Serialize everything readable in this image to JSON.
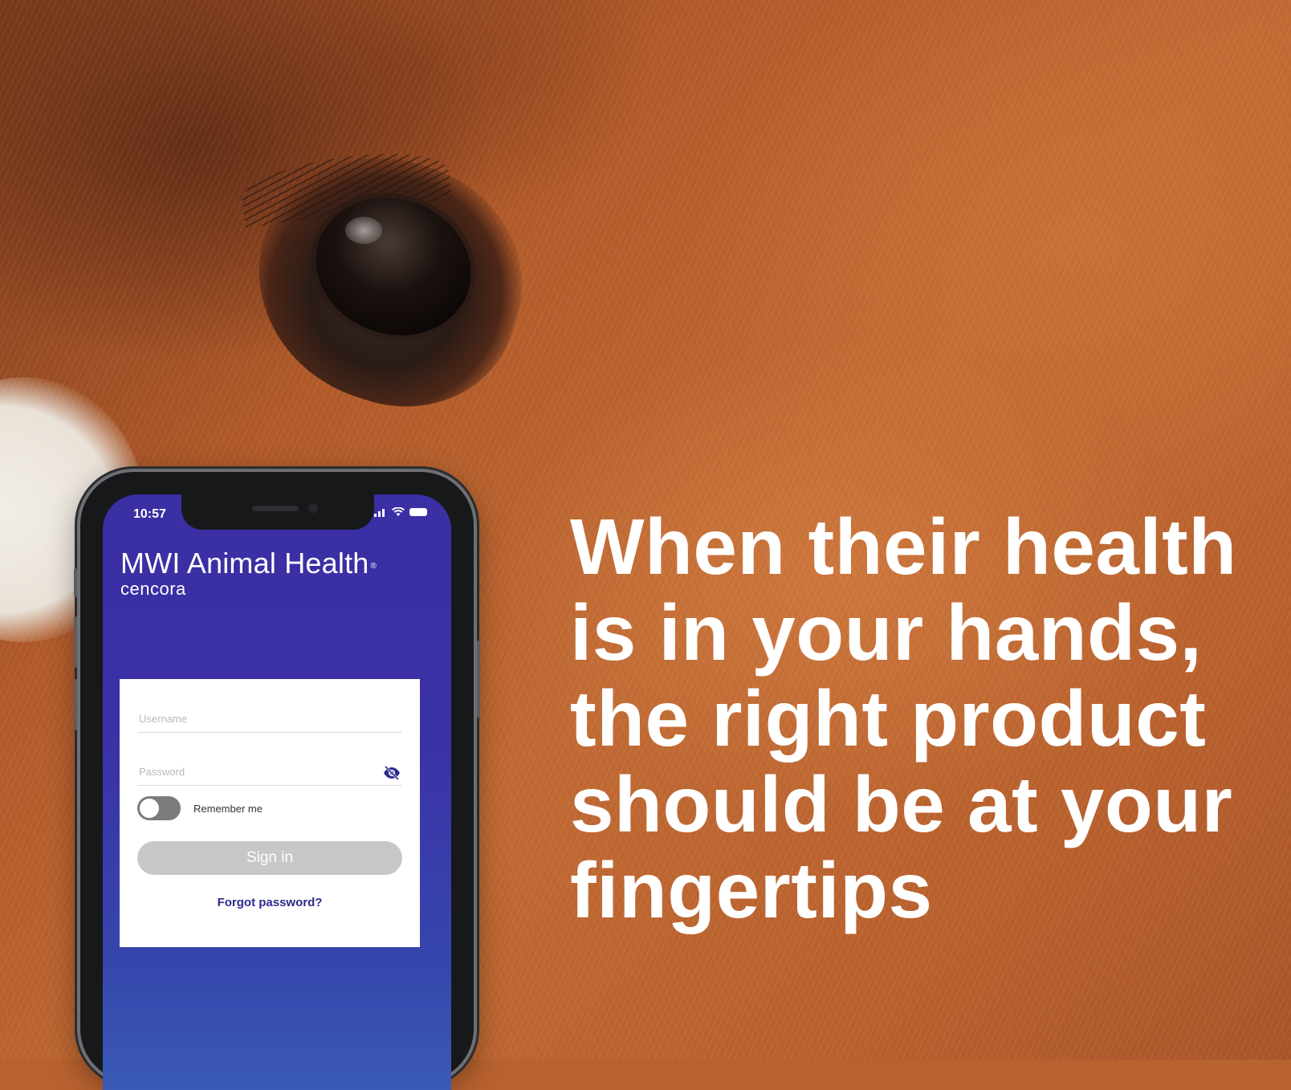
{
  "headline": {
    "lines": [
      "When their health",
      "is in your hands,",
      "the right product",
      "should be at your",
      "fingertips"
    ]
  },
  "phone": {
    "status_bar": {
      "time": "10:57",
      "icons": [
        "signal-icon",
        "wifi-icon",
        "battery-icon"
      ]
    },
    "brand": {
      "name": "MWI Animal Health",
      "registered_mark": "®",
      "subtitle": "cencora"
    },
    "login": {
      "username_placeholder": "Username",
      "password_placeholder": "Password",
      "password_toggle_icon": "eye-off-icon",
      "remember_label": "Remember me",
      "remember_on": false,
      "signin_label": "Sign in",
      "forgot_label": "Forgot password?"
    }
  },
  "colors": {
    "app_purple": "#3a2fa3",
    "link_navy": "#2d2a8c",
    "button_disabled": "#c7c7ca",
    "headline_white": "#ffffff"
  }
}
